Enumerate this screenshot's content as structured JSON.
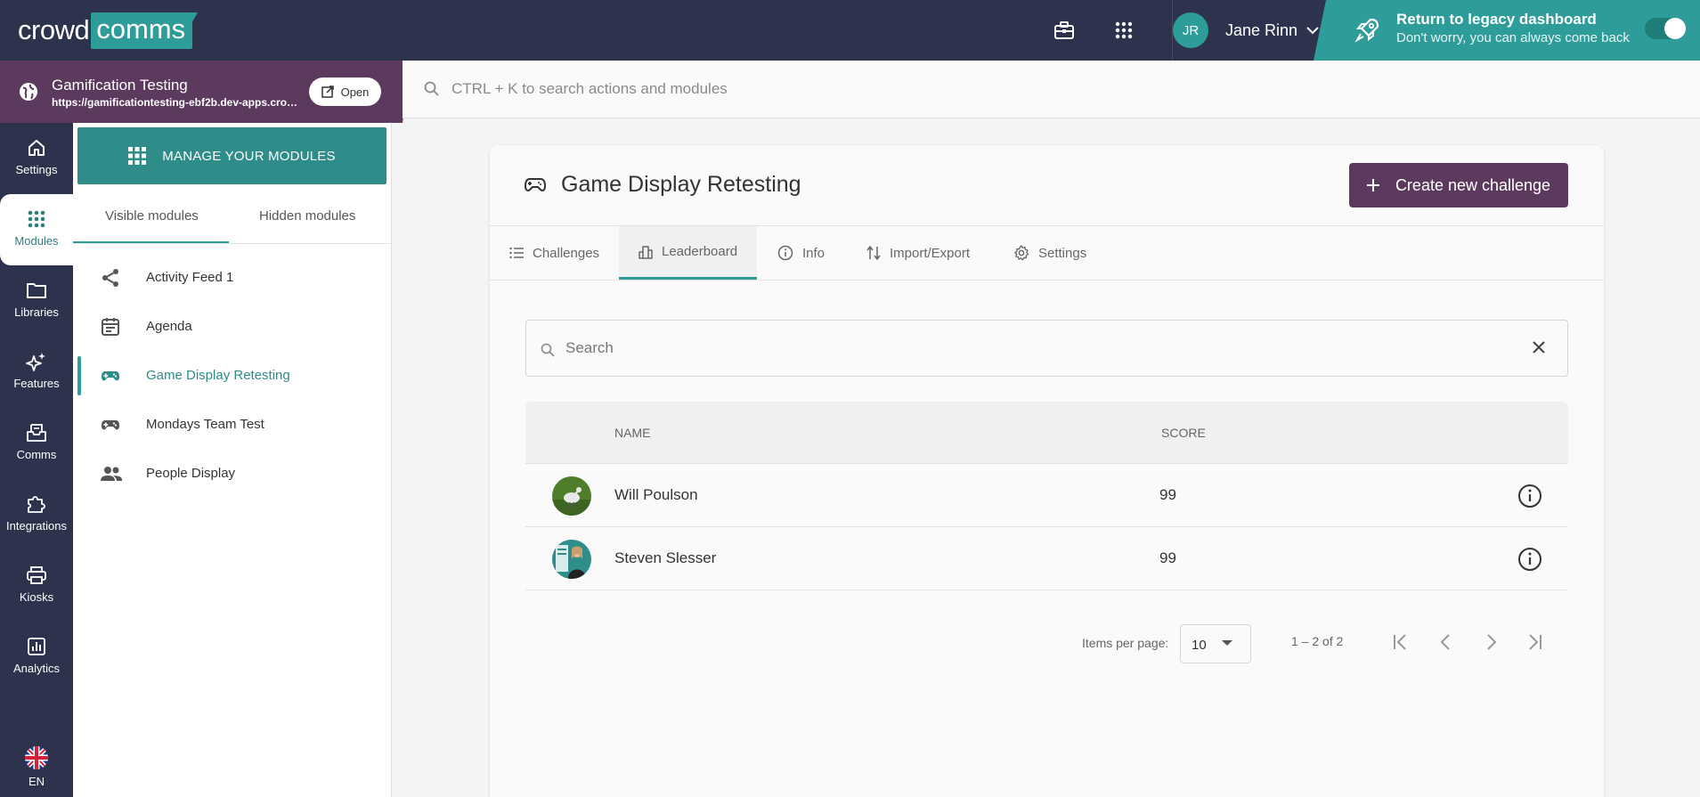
{
  "header": {
    "logo_left": "crowd",
    "logo_right": "comms",
    "user_initials": "JR",
    "user_name": "Jane Rinn",
    "legacy_title": "Return to legacy dashboard",
    "legacy_subtitle": "Don't worry, you can always come back"
  },
  "event": {
    "title": "Gamification Testing",
    "url": "https://gamificationtesting-ebf2b.dev-apps.crowdcomms.com",
    "open_label": "Open"
  },
  "search": {
    "placeholder": "CTRL + K to search actions and modules"
  },
  "nav": {
    "items": [
      {
        "label": "Settings",
        "icon": "home-icon"
      },
      {
        "label": "Modules",
        "icon": "grid-icon"
      },
      {
        "label": "Libraries",
        "icon": "folder-icon"
      },
      {
        "label": "Features",
        "icon": "sparkle-icon"
      },
      {
        "label": "Comms",
        "icon": "inbox-icon"
      },
      {
        "label": "Integrations",
        "icon": "puzzle-icon"
      },
      {
        "label": "Kiosks",
        "icon": "printer-icon"
      },
      {
        "label": "Analytics",
        "icon": "chart-icon"
      }
    ],
    "language": "EN"
  },
  "modules": {
    "manage_label": "MANAGE YOUR MODULES",
    "tab_visible": "Visible modules",
    "tab_hidden": "Hidden modules",
    "items": [
      {
        "label": "Activity Feed 1",
        "icon": "share-icon"
      },
      {
        "label": "Agenda",
        "icon": "calendar-icon"
      },
      {
        "label": "Game Display Retesting",
        "icon": "gamepad-icon"
      },
      {
        "label": "Mondays Team Test",
        "icon": "gamepad-icon"
      },
      {
        "label": "People Display",
        "icon": "people-icon"
      }
    ]
  },
  "card": {
    "title": "Game Display Retesting",
    "create_label": "Create new challenge",
    "tabs": [
      "Challenges",
      "Leaderboard",
      "Info",
      "Import/Export",
      "Settings"
    ],
    "search_placeholder": "Search",
    "col_name": "NAME",
    "col_score": "SCORE",
    "rows": [
      {
        "name": "Will Poulson",
        "score": "99"
      },
      {
        "name": "Steven Slesser",
        "score": "99"
      }
    ],
    "items_per_page_label": "Items per page:",
    "items_per_page": "10",
    "range": "1 – 2 of 2"
  },
  "colors": {
    "nav_bg": "#2e334d",
    "teal": "#2e9c98",
    "plum": "#5c3a5e"
  }
}
